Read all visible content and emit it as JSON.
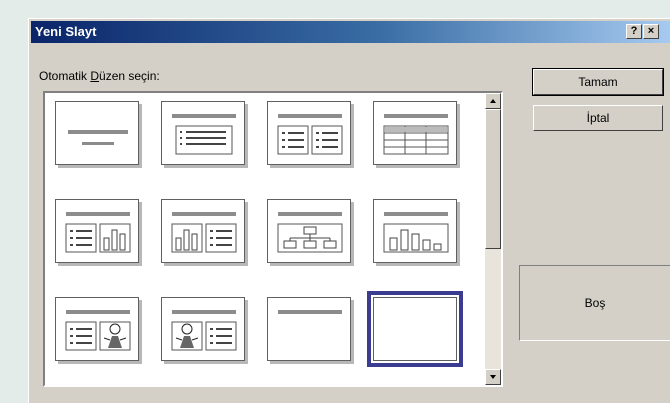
{
  "window": {
    "title": "Yeni Slayt",
    "help_label": "?",
    "close_label": "×"
  },
  "layout_label": {
    "prefix": "Otomatik ",
    "underlined": "D",
    "suffix": "üzen seçin:"
  },
  "buttons": {
    "ok": "Tamam",
    "cancel": "İptal"
  },
  "preview": {
    "text": "Boş"
  },
  "layouts": [
    {
      "id": "title"
    },
    {
      "id": "bulleted-list"
    },
    {
      "id": "two-column-text"
    },
    {
      "id": "table"
    },
    {
      "id": "text-and-chart"
    },
    {
      "id": "chart-and-text"
    },
    {
      "id": "org-chart"
    },
    {
      "id": "chart"
    },
    {
      "id": "text-and-clip-art"
    },
    {
      "id": "clip-art-and-text"
    },
    {
      "id": "title-only"
    },
    {
      "id": "blank",
      "selected": true
    }
  ]
}
